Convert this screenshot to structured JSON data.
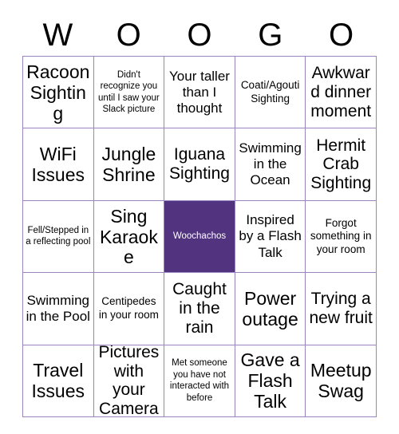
{
  "card": {
    "title": "Bingo Card",
    "header_letters": [
      "W",
      "O",
      "O",
      "G",
      "O"
    ],
    "colors": {
      "grid_border": "#9a85c0",
      "marked_background": "#523380",
      "marked_text": "#ffffff",
      "cell_background": "#ffffff",
      "text": "#000000"
    },
    "rows": [
      [
        {
          "text": "Racoon Sighting",
          "marked": false,
          "size": "xl"
        },
        {
          "text": "Didn't recognize you until I saw your Slack picture",
          "marked": false,
          "size": "xs"
        },
        {
          "text": "Your taller than I thought",
          "marked": false,
          "size": "md"
        },
        {
          "text": "Coati/Agouti Sighting",
          "marked": false,
          "size": "sm"
        },
        {
          "text": "Awkward dinner moment",
          "marked": false,
          "size": "lg"
        }
      ],
      [
        {
          "text": "WiFi Issues",
          "marked": false,
          "size": "xl"
        },
        {
          "text": "Jungle Shrine",
          "marked": false,
          "size": "xl"
        },
        {
          "text": "Iguana Sighting",
          "marked": false,
          "size": "lg"
        },
        {
          "text": "Swimming in the Ocean",
          "marked": false,
          "size": "md"
        },
        {
          "text": "Hermit Crab Sighting",
          "marked": false,
          "size": "lg"
        }
      ],
      [
        {
          "text": "Fell/Stepped in a reflecting pool",
          "marked": false,
          "size": "xs"
        },
        {
          "text": "Sing Karaoke",
          "marked": false,
          "size": "xl"
        },
        {
          "text": "Woochachos",
          "marked": true,
          "size": "xs"
        },
        {
          "text": "Inspired by a Flash Talk",
          "marked": false,
          "size": "md"
        },
        {
          "text": "Forgot something in your room",
          "marked": false,
          "size": "sm"
        }
      ],
      [
        {
          "text": "Swimming in the Pool",
          "marked": false,
          "size": "md"
        },
        {
          "text": "Centipedes in your room",
          "marked": false,
          "size": "sm"
        },
        {
          "text": "Caught in the rain",
          "marked": false,
          "size": "lg"
        },
        {
          "text": "Power outage",
          "marked": false,
          "size": "xl"
        },
        {
          "text": "Trying a new fruit",
          "marked": false,
          "size": "lg"
        }
      ],
      [
        {
          "text": "Travel Issues",
          "marked": false,
          "size": "xl"
        },
        {
          "text": "Pictures with your Camera",
          "marked": false,
          "size": "lg"
        },
        {
          "text": "Met someone you have not interacted with before",
          "marked": false,
          "size": "xs"
        },
        {
          "text": "Gave a Flash Talk",
          "marked": false,
          "size": "xl"
        },
        {
          "text": "Meetup Swag",
          "marked": false,
          "size": "xl"
        }
      ]
    ]
  }
}
